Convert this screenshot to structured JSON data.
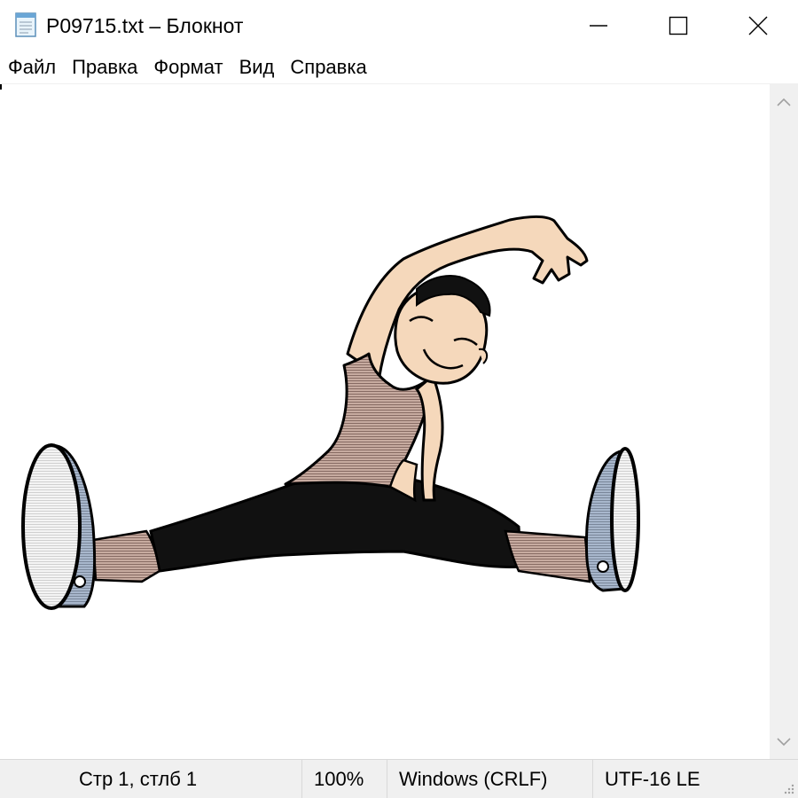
{
  "window": {
    "title": "P09715.txt – Блокнот",
    "icons": {
      "app": "notepad-icon",
      "minimize": "minimize-icon",
      "maximize": "maximize-icon",
      "close": "close-icon"
    }
  },
  "menu": {
    "items": [
      {
        "label": "Файл"
      },
      {
        "label": "Правка"
      },
      {
        "label": "Формат"
      },
      {
        "label": "Вид"
      },
      {
        "label": "Справка"
      }
    ]
  },
  "editor": {
    "content_image": "stretching-person-illustration"
  },
  "status": {
    "position": "Стр 1, стлб 1",
    "zoom": "100%",
    "line_endings": "Windows (CRLF)",
    "encoding": "UTF-16 LE"
  },
  "colors": {
    "skin": "#f5d8bb",
    "shirt": "#c7aba0",
    "pants": "#111111",
    "shoe": "#a8b7cc",
    "sole": "#f4f4f4",
    "chrome": "#f0f0f0"
  }
}
